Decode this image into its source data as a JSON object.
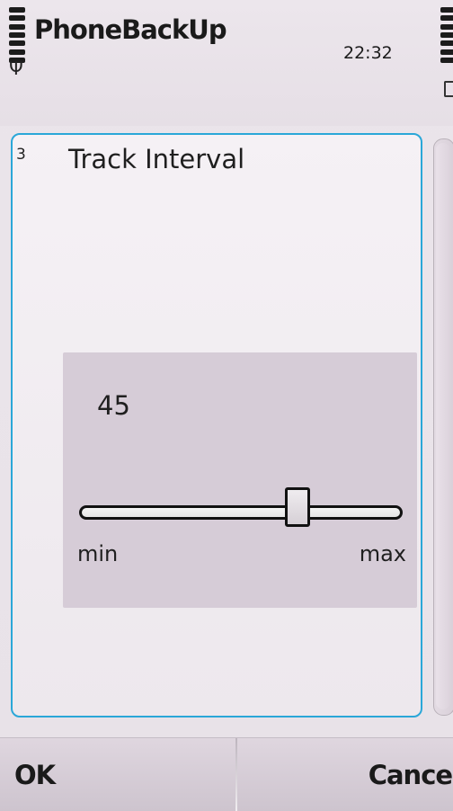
{
  "app": {
    "title": "PhoneBackUp",
    "time": "22:32"
  },
  "dialog": {
    "index": "3",
    "title": "Track Interval",
    "slider": {
      "value": 45,
      "value_label": "45",
      "min_label": "min",
      "max_label": "max",
      "position_fraction": 0.69
    }
  },
  "softkeys": {
    "left": "OK",
    "right": "Cancel"
  },
  "colors": {
    "focus_border": "#2aa7d8",
    "slider_panel": "#d6ccd7"
  },
  "icons": {
    "signal": "signal-strength-icon",
    "antenna": "antenna-icon",
    "battery": "battery-icon"
  }
}
